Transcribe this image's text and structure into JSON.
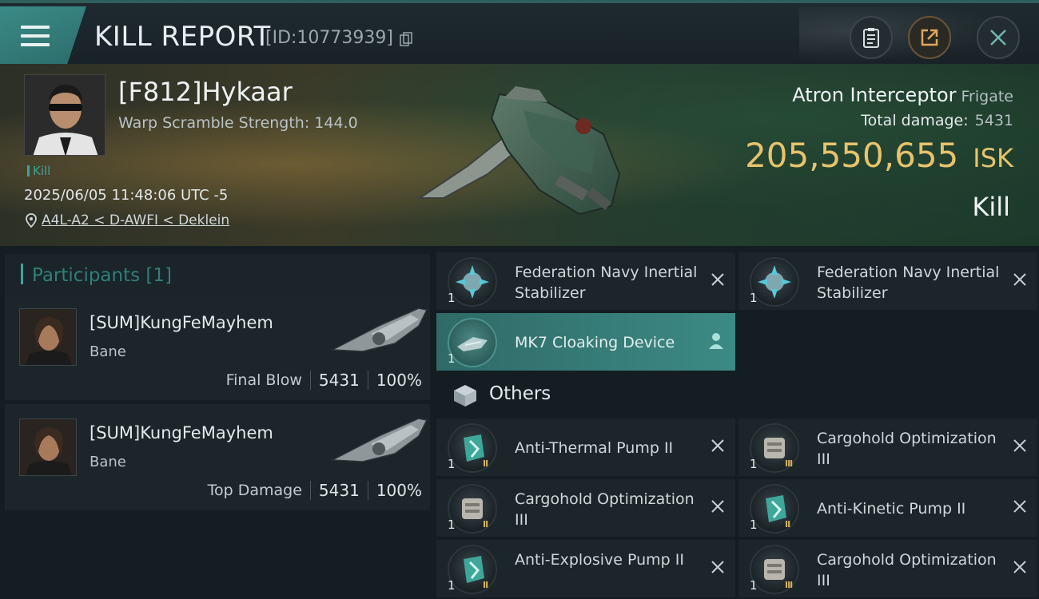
{
  "header": {
    "title": "KILL REPORT",
    "report_id": "[ID:10773939]",
    "buttons": [
      "clipboard",
      "share",
      "close"
    ]
  },
  "victim": {
    "name": "[F812]Hykaar",
    "stat": "Warp Scramble Strength: 144.0",
    "tag": "Kill",
    "datetime": "2025/06/05 11:48:06 UTC -5",
    "location": "A4L-A2 < D-AWFI < Deklein"
  },
  "ship": {
    "name": "Atron Interceptor",
    "class": "Frigate",
    "total_damage_label": "Total damage:",
    "total_damage": "5431",
    "isk_value": "205,550,655",
    "isk_unit": "ISK",
    "result": "Kill"
  },
  "participants": {
    "title": "Participants [1]",
    "rows": [
      {
        "name": "[SUM]KungFeMayhem",
        "ship": "Bane",
        "label": "Final Blow",
        "damage": "5431",
        "percent": "100%"
      },
      {
        "name": "[SUM]KungFeMayhem",
        "ship": "Bane",
        "label": "Top Damage",
        "damage": "5431",
        "percent": "100%"
      }
    ]
  },
  "modules": [
    {
      "name": "Federation Navy Inertial Stabilizer",
      "qty": "1"
    },
    {
      "name": "Federation Navy Inertial Stabilizer",
      "qty": "1"
    },
    {
      "name": "MK7 Cloaking Device",
      "qty": "1"
    }
  ],
  "others": {
    "title": "Others",
    "items": [
      {
        "name": "Anti-Thermal Pump II",
        "qty": "1",
        "tier": "II"
      },
      {
        "name": "Cargohold Optimization III",
        "qty": "1",
        "tier": "III"
      },
      {
        "name": "Cargohold Optimization III",
        "qty": "1",
        "tier": "II"
      },
      {
        "name": "Anti-Kinetic Pump II",
        "qty": "1",
        "tier": "II"
      },
      {
        "name": "Anti-Explosive Pump II",
        "qty": "1",
        "tier": "II"
      },
      {
        "name": "Cargohold Optimization III",
        "qty": "1",
        "tier": "III"
      }
    ]
  },
  "colors": {
    "accent": "#3fa39c",
    "isk": "#e8c36c",
    "highlight": "#3c8a85"
  }
}
